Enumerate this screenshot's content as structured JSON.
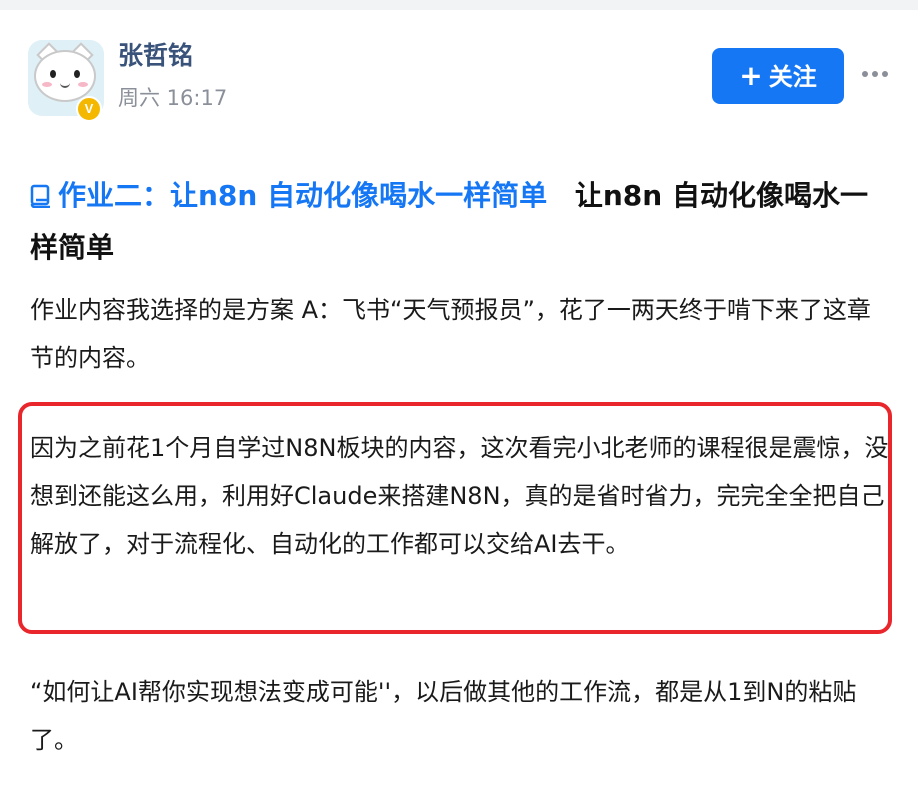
{
  "author": {
    "name": "张哲铭",
    "meta": "周六 16:17",
    "badge": "V"
  },
  "actions": {
    "follow_label": "关注",
    "follow_icon": "plus-icon",
    "more_icon": "more-dots-icon"
  },
  "post": {
    "title_link": "作业二：让n8n 自动化像喝水一样简单",
    "title_link_icon": "document-icon",
    "title_rest": "让n8n 自动化像喝水一样简单",
    "paragraphs": [
      "作业内容我选择的是方案 A：飞书“天气预报员”，花了一两天终于啃下来了这章节的内容。",
      "因为之前花1个月自学过N8N板块的内容，这次看完小北老师的课程很是震惊，没想到还能这么用，利用好Claude来搭建N8N，真的是省时省力，完完全全把自己解放了，对于流程化、自动化的工作都可以交给AI去干。",
      "“如何让AI帮你实现想法变成可能''，以后做其他的工作流，都是从1到N的粘贴了。"
    ]
  },
  "colors": {
    "accent": "#1677f5",
    "username": "#39537a",
    "highlight_border": "#e8262b",
    "muted": "#8a8f99"
  }
}
